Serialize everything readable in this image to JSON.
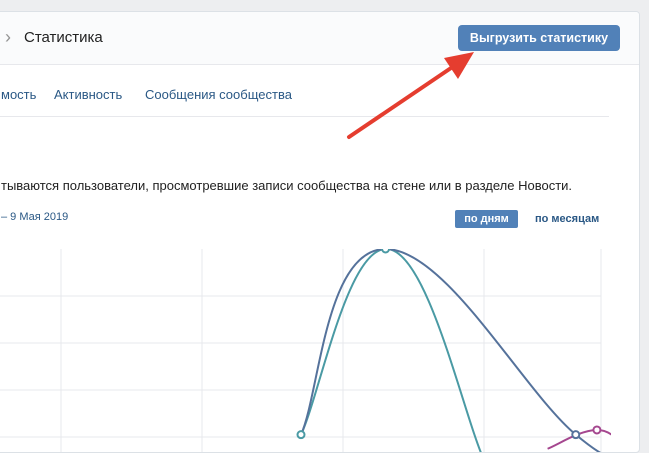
{
  "header": {
    "chevron_icon": "chevron-right-icon",
    "title": "Статистика",
    "export_button_label": "Выгрузить статистику"
  },
  "tabs": [
    {
      "label": "мость"
    },
    {
      "label": "Активность"
    },
    {
      "label": "Сообщения сообщества"
    }
  ],
  "section": {
    "description": "тываются пользователи, просмотревшие записи сообщества на стене или в разделе Новости.",
    "date_range": "– 9 Мая 2019",
    "toggle_by_days": "по дням",
    "toggle_by_months": "по месяцам",
    "selected_toggle": "по дням"
  },
  "colors": {
    "accent": "#5181b8",
    "link": "#2a5885",
    "series_teal": "#4a9aa4",
    "series_navy": "#55729b",
    "series_magenta": "#a5478f",
    "annotation_arrow": "#e53d2f"
  },
  "annotation": {
    "type": "arrow",
    "points_to": "export-button"
  },
  "chart_data": {
    "type": "line",
    "grid": true,
    "legend": "none",
    "x_range": [
      0,
      4.4
    ],
    "y_range": [
      0,
      8
    ],
    "series": [
      {
        "color": "#4a9aa4",
        "x": [
          2.2,
          2.82,
          3.5
        ],
        "y": [
          0.1,
          8.0,
          -1.0
        ]
      },
      {
        "color": "#55729b",
        "x": [
          2.2,
          2.8,
          4.15,
          4.5
        ],
        "y": [
          0.1,
          8.0,
          0.1,
          -0.5
        ]
      },
      {
        "color": "#a5478f",
        "x": [
          3.95,
          4.3,
          4.5
        ],
        "y": [
          -0.5,
          0.3,
          -0.5
        ]
      }
    ],
    "points": [
      {
        "x": 2.2,
        "y": 0.1,
        "color": "#4a9aa4"
      },
      {
        "x": 2.8,
        "y": 8.0,
        "color": "#4a9aa4"
      },
      {
        "x": 4.15,
        "y": 0.1,
        "color": "#55729b"
      },
      {
        "x": 4.3,
        "y": 0.3,
        "color": "#a5478f"
      }
    ]
  }
}
